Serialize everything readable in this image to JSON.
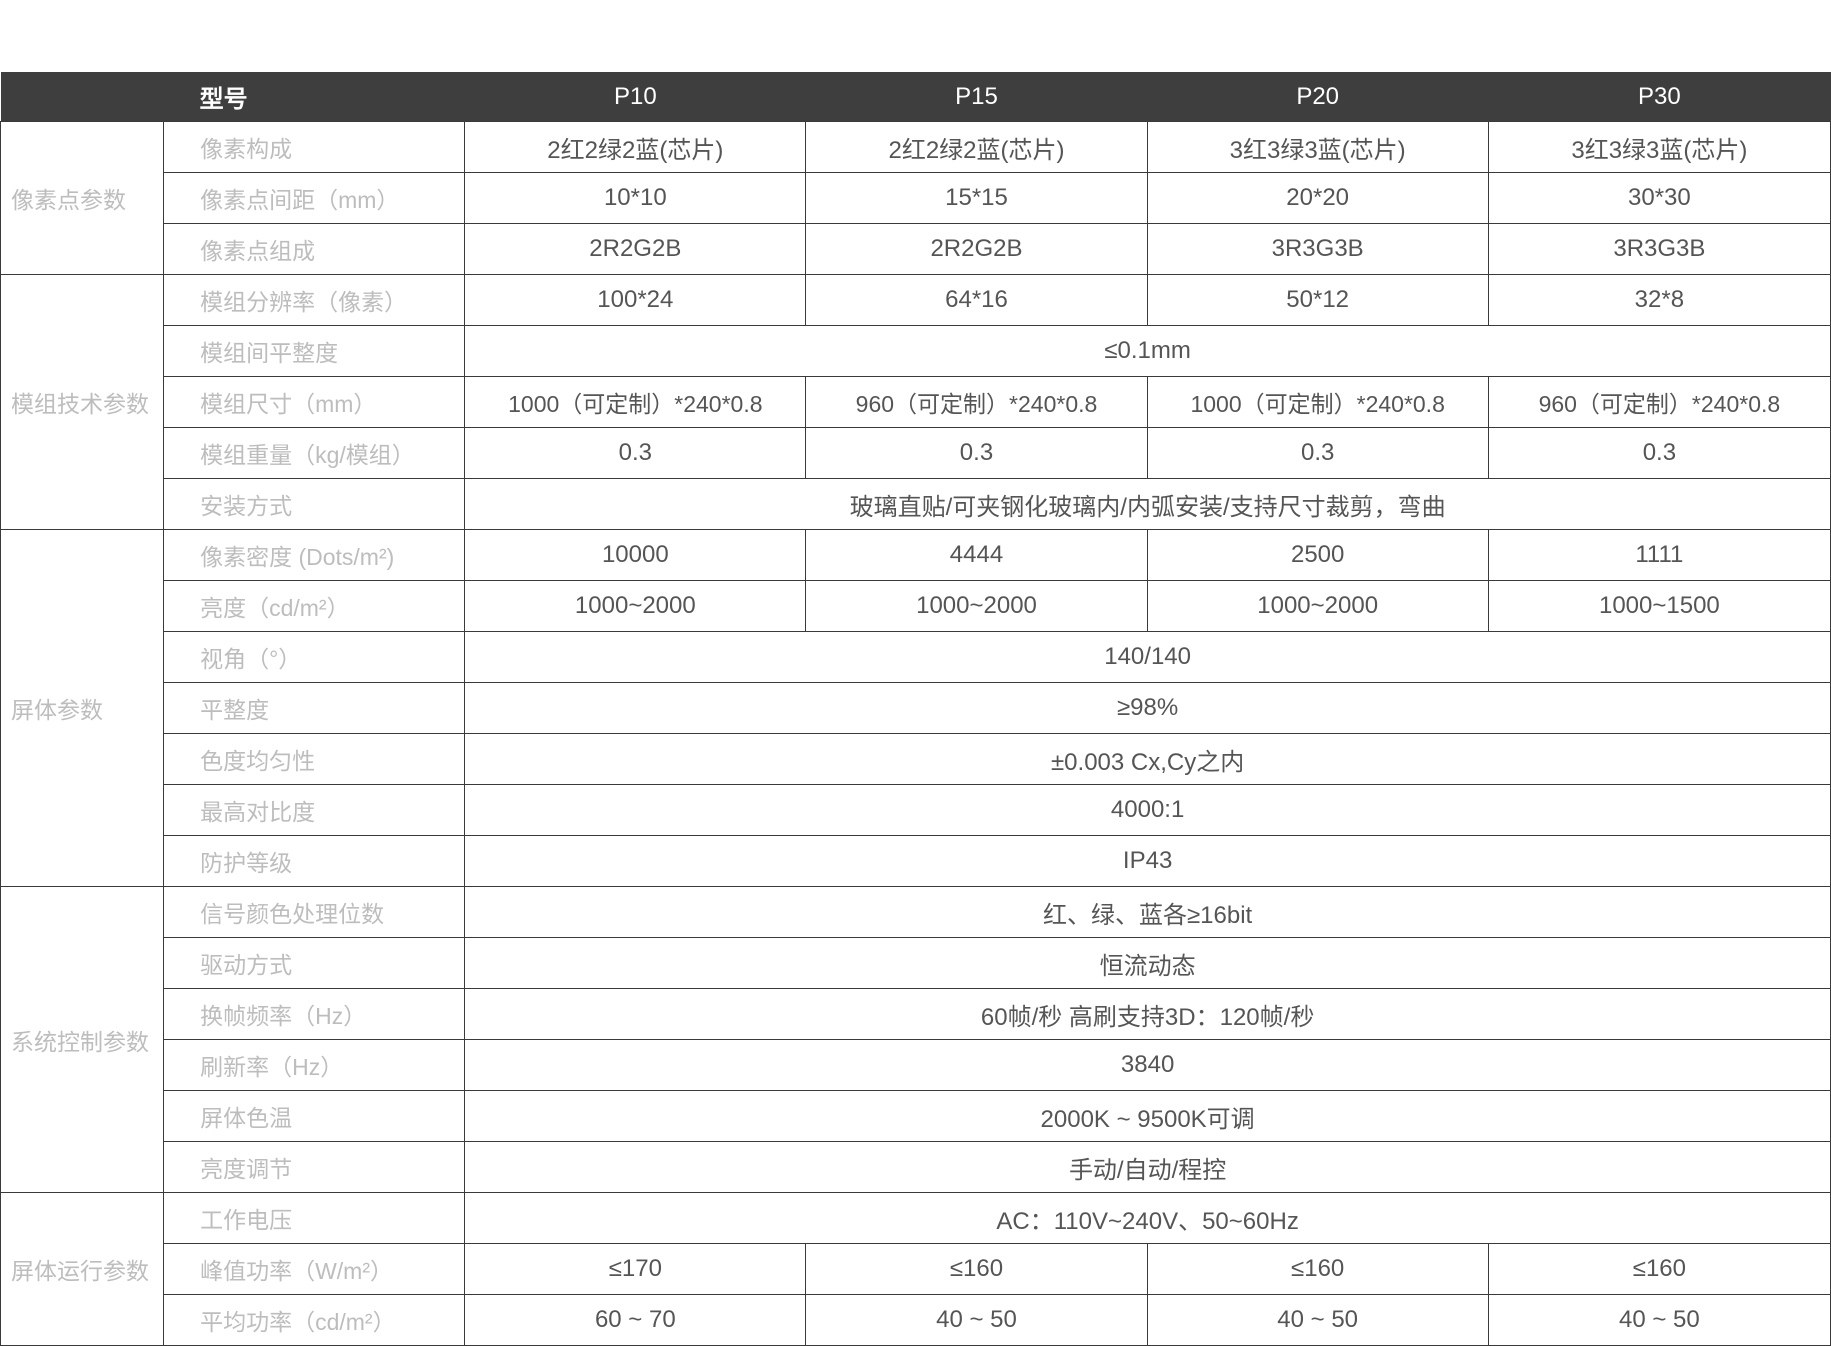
{
  "header": {
    "model_label": "型号",
    "models": [
      "P10",
      "P15",
      "P20",
      "P30"
    ]
  },
  "groups": [
    {
      "name": "像素点参数",
      "rows": [
        {
          "param": "像素构成",
          "values": [
            "2红2绿2蓝(芯片)",
            "2红2绿2蓝(芯片)",
            "3红3绿3蓝(芯片)",
            "3红3绿3蓝(芯片)"
          ]
        },
        {
          "param": "像素点间距（mm）",
          "values": [
            "10*10",
            "15*15",
            "20*20",
            "30*30"
          ]
        },
        {
          "param": "像素点组成",
          "values": [
            "2R2G2B",
            "2R2G2B",
            "3R3G3B",
            "3R3G3B"
          ]
        }
      ]
    },
    {
      "name": "模组技术参数",
      "rows": [
        {
          "param": "模组分辨率（像素）",
          "values": [
            "100*24",
            "64*16",
            "50*12",
            "32*8"
          ]
        },
        {
          "param": "模组间平整度",
          "values": [
            "≤0.1mm"
          ]
        },
        {
          "param": "模组尺寸（mm）",
          "values": [
            "1000（可定制）*240*0.8",
            "960（可定制）*240*0.8",
            "1000（可定制）*240*0.8",
            "960（可定制）*240*0.8"
          ]
        },
        {
          "param": "模组重量（kg/模组）",
          "values": [
            "0.3",
            "0.3",
            "0.3",
            "0.3"
          ]
        },
        {
          "param": "安装方式",
          "values": [
            "玻璃直贴/可夹钢化玻璃内/内弧安装/支持尺寸裁剪，弯曲"
          ]
        }
      ]
    },
    {
      "name": "屏体参数",
      "rows": [
        {
          "param": "像素密度 (Dots/m²)",
          "values": [
            "10000",
            "4444",
            "2500",
            "1111"
          ]
        },
        {
          "param": "亮度（cd/m²）",
          "values": [
            "1000~2000",
            "1000~2000",
            "1000~2000",
            "1000~1500"
          ]
        },
        {
          "param": "视角（°）",
          "values": [
            "140/140"
          ]
        },
        {
          "param": "平整度",
          "values": [
            "≥98%"
          ]
        },
        {
          "param": "色度均匀性",
          "values": [
            "±0.003   Cx,Cy之内"
          ]
        },
        {
          "param": "最高对比度",
          "values": [
            "4000:1"
          ]
        },
        {
          "param": "防护等级",
          "values": [
            "IP43"
          ]
        }
      ]
    },
    {
      "name": "系统控制参数",
      "rows": [
        {
          "param": "信号颜色处理位数",
          "values": [
            "红、绿、蓝各≥16bit"
          ]
        },
        {
          "param": "驱动方式",
          "values": [
            "恒流动态"
          ]
        },
        {
          "param": "换帧频率（Hz）",
          "values": [
            "60帧/秒    高刷支持3D：120帧/秒"
          ]
        },
        {
          "param": "刷新率（Hz）",
          "values": [
            "3840"
          ]
        },
        {
          "param": "屏体色温",
          "values": [
            "2000K ~ 9500K可调"
          ]
        },
        {
          "param": "亮度调节",
          "values": [
            "手动/自动/程控"
          ]
        }
      ]
    },
    {
      "name": "屏体运行参数",
      "rows": [
        {
          "param": "工作电压",
          "values": [
            "AC：110V~240V、50~60Hz"
          ]
        },
        {
          "param": "峰值功率（W/m²）",
          "values": [
            "≤170",
            "≤160",
            "≤160",
            "≤160"
          ]
        },
        {
          "param": "平均功率（cd/m²）",
          "values": [
            "60 ~ 70",
            "40 ~ 50",
            "40 ~ 50",
            "40 ~ 50"
          ]
        }
      ]
    }
  ]
}
